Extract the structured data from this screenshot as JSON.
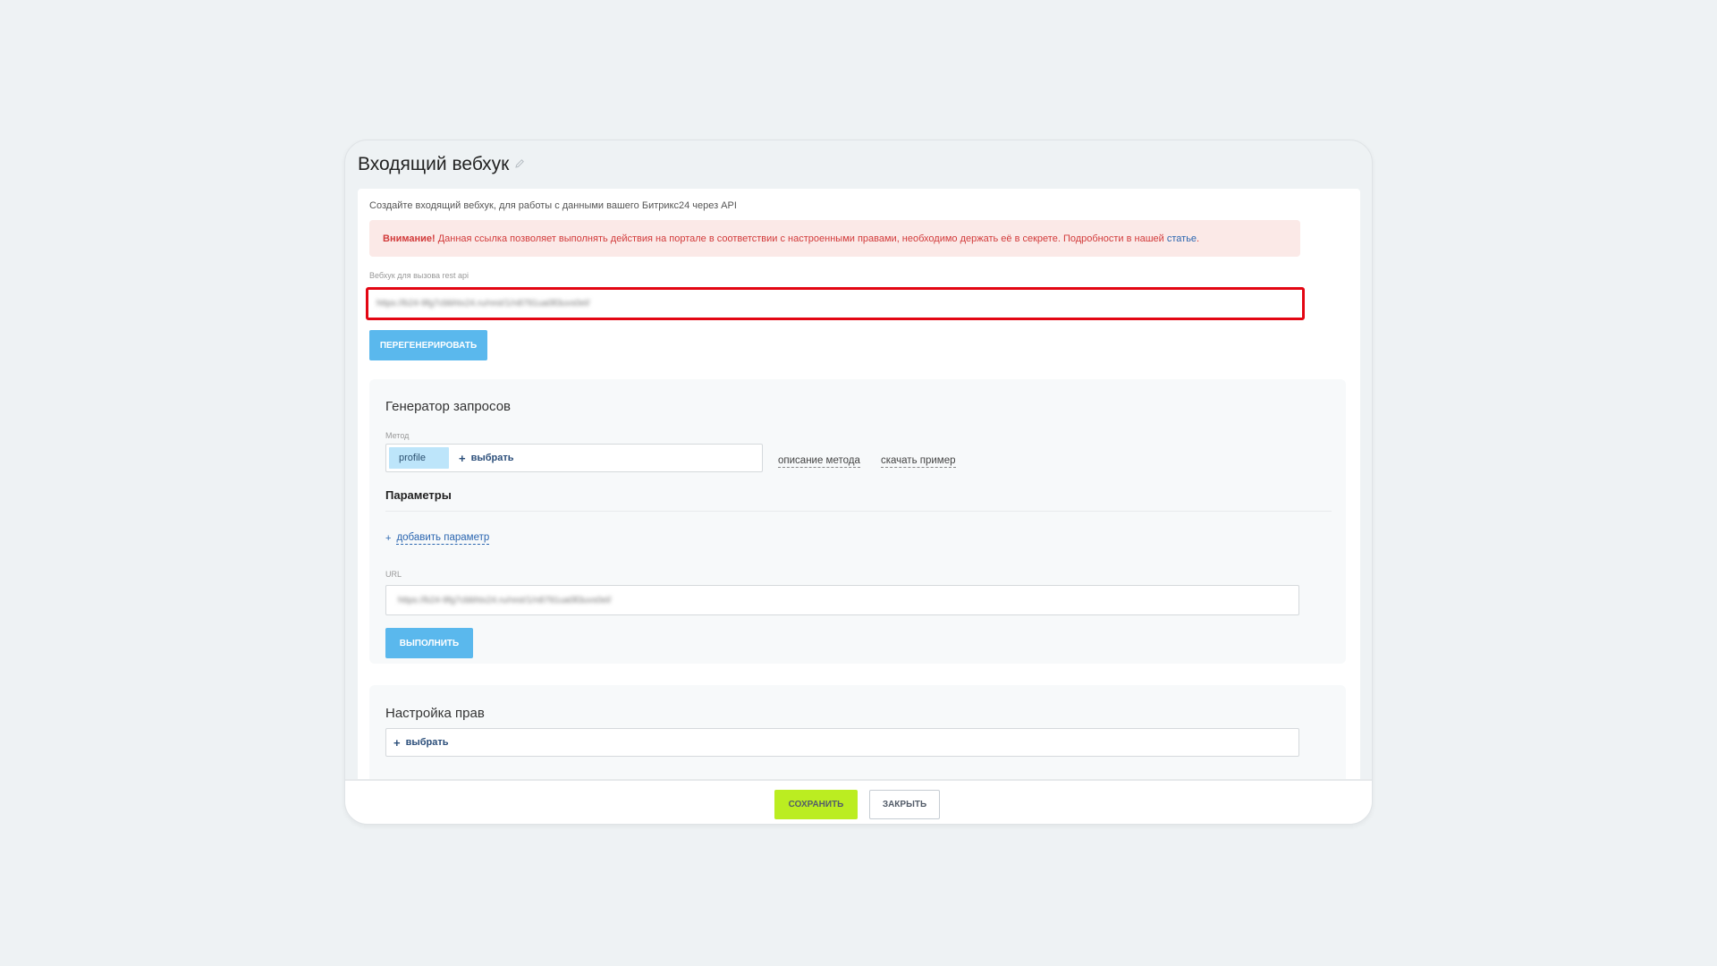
{
  "page": {
    "title": "Входящий вебхук",
    "hint": "Создайте входящий вебхук, для работы с данными вашего Битрикс24 через API"
  },
  "alert": {
    "strong": "Внимание!",
    "text": " Данная ссылка позволяет выполнять действия на портале в соответствии с настроенными правами, необходимо держать её в секрете. Подробности в нашей ",
    "link": "статье",
    "end": "."
  },
  "webhook": {
    "label": "Вебхук для вызова rest api",
    "value": "https://b24-9fg7cbbhtx24.ru/rest/1/n8791ua0ll3uvs0el/",
    "regenerate_label": "ПЕРЕГЕНЕРИРОВАТЬ"
  },
  "generator": {
    "title": "Генератор запросов",
    "method_label": "Метод",
    "method_value": "profile",
    "select_label": "выбрать",
    "describe_link": "описание метода",
    "download_link": "скачать пример",
    "params_title": "Параметры",
    "add_param": "добавить параметр",
    "url_label": "URL",
    "url_value": "https://b24-9fg7cbbhtx24.ru/rest/1/n8791ua0ll3uvs0el/",
    "run_label": "ВЫПОЛНИТЬ"
  },
  "rights": {
    "title": "Настройка прав",
    "select_label": "выбрать"
  },
  "footer": {
    "save_label": "СОХРАНИТЬ",
    "close_label": "ЗАКРЫТЬ"
  },
  "colors": {
    "highlight_border": "#e30613",
    "primary_button": "#5ab8ed",
    "save_button": "#bbed21",
    "alert_bg": "#fbe9e7",
    "alert_text": "#d23b3b"
  }
}
